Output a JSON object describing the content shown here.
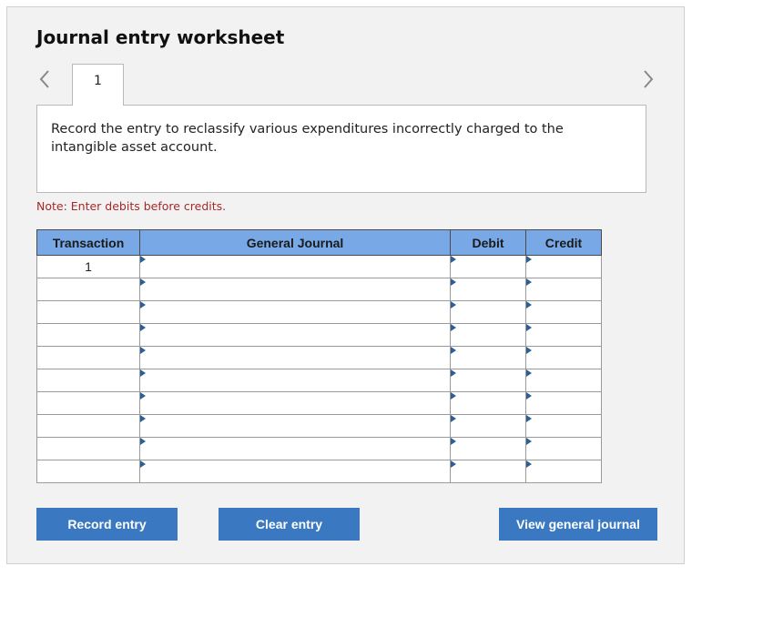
{
  "worksheet": {
    "title": "Journal entry worksheet",
    "active_tab": "1",
    "instructions": "Record the entry to reclassify various expenditures incorrectly charged to the intangible asset account.",
    "note": "Note: Enter debits before credits."
  },
  "navigation": {
    "prev_icon": "chevron-left-icon",
    "next_icon": "chevron-right-icon",
    "arrow_color": "#888888"
  },
  "table": {
    "headers": {
      "transaction": "Transaction",
      "general_journal": "General Journal",
      "debit": "Debit",
      "credit": "Credit"
    },
    "header_color": "#78a9e6",
    "rows": [
      {
        "transaction": "1",
        "account": "",
        "debit": "",
        "credit": ""
      },
      {
        "transaction": "",
        "account": "",
        "debit": "",
        "credit": ""
      },
      {
        "transaction": "",
        "account": "",
        "debit": "",
        "credit": ""
      },
      {
        "transaction": "",
        "account": "",
        "debit": "",
        "credit": ""
      },
      {
        "transaction": "",
        "account": "",
        "debit": "",
        "credit": ""
      },
      {
        "transaction": "",
        "account": "",
        "debit": "",
        "credit": ""
      },
      {
        "transaction": "",
        "account": "",
        "debit": "",
        "credit": ""
      },
      {
        "transaction": "",
        "account": "",
        "debit": "",
        "credit": ""
      },
      {
        "transaction": "",
        "account": "",
        "debit": "",
        "credit": ""
      },
      {
        "transaction": "",
        "account": "",
        "debit": "",
        "credit": ""
      }
    ]
  },
  "buttons": {
    "record": "Record entry",
    "clear": "Clear entry",
    "view": "View general journal",
    "color": "#3a78c1"
  }
}
